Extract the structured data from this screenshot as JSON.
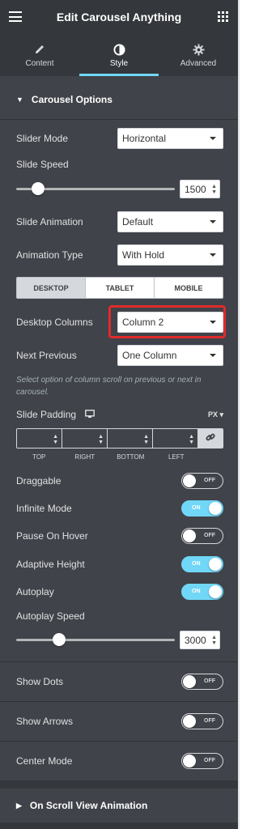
{
  "header": {
    "title": "Edit Carousel Anything",
    "menu_icon": "hamburger-icon",
    "apps_icon": "grid-icon"
  },
  "tabs": [
    {
      "label": "Content",
      "icon": "pencil-icon"
    },
    {
      "label": "Style",
      "icon": "contrast-icon",
      "active": true
    },
    {
      "label": "Advanced",
      "icon": "gear-icon"
    }
  ],
  "accent_color": "#71d7f7",
  "highlight_color": "#e02b2b",
  "carousel_options": {
    "heading": "Carousel Options",
    "slider_mode": {
      "label": "Slider Mode",
      "value": "Horizontal"
    },
    "slide_speed": {
      "label": "Slide Speed",
      "value": "1500",
      "slider_fraction": 0.14
    },
    "slide_animation": {
      "label": "Slide Animation",
      "value": "Default"
    },
    "animation_type": {
      "label": "Animation Type",
      "value": "With Hold"
    },
    "device_tabs": [
      "DESKTOP",
      "TABLET",
      "MOBILE"
    ],
    "desktop_columns": {
      "label": "Desktop Columns",
      "value": "Column 2"
    },
    "next_previous": {
      "label": "Next Previous",
      "value": "One Column"
    },
    "hint": "Select option of column scroll on previous or next in carousel.",
    "slide_padding": {
      "label": "Slide Padding",
      "unit": "PX",
      "sides": [
        "TOP",
        "RIGHT",
        "BOTTOM",
        "LEFT"
      ]
    },
    "draggable": {
      "label": "Draggable",
      "state": "OFF"
    },
    "infinite_mode": {
      "label": "Infinite Mode",
      "state": "ON"
    },
    "pause_on_hover": {
      "label": "Pause On Hover",
      "state": "OFF"
    },
    "adaptive_height": {
      "label": "Adaptive Height",
      "state": "ON"
    },
    "autoplay": {
      "label": "Autoplay",
      "state": "ON"
    },
    "autoplay_speed": {
      "label": "Autoplay Speed",
      "value": "3000",
      "slider_fraction": 0.27
    },
    "show_dots": {
      "label": "Show Dots",
      "state": "OFF"
    },
    "show_arrows": {
      "label": "Show Arrows",
      "state": "OFF"
    },
    "center_mode": {
      "label": "Center Mode",
      "state": "OFF"
    }
  },
  "scroll_section": {
    "heading": "On Scroll View Animation"
  }
}
